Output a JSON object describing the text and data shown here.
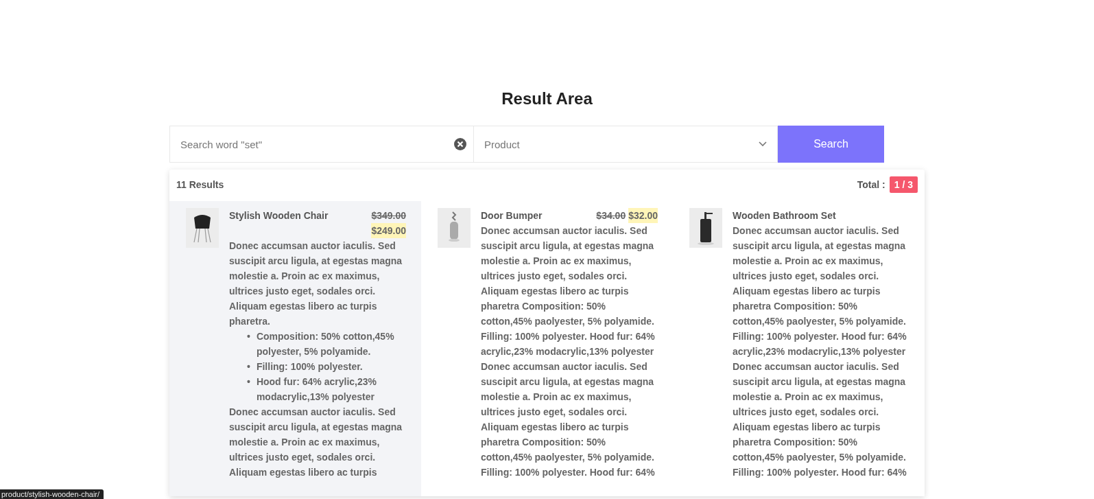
{
  "title": "Result Area",
  "search": {
    "placeholder": "Search word \"set\"",
    "category": "Product",
    "button": "Search"
  },
  "results": {
    "count": "11 Results",
    "total_label": "Total :",
    "page": "1 / 3",
    "items": [
      {
        "kind": "list",
        "hovered": true,
        "name": "Stylish Wooden Chair",
        "old_price": "$349.00",
        "price": "$249.00",
        "paragraphs": [
          "Donec accumsan auctor iaculis. Sed suscipit arcu ligula, at egestas magna molestie a. Proin ac ex maximus, ultrices justo eget, sodales orci. Aliquam egestas libero ac turpis pharetra."
        ],
        "bullets": [
          {
            "marker": "•",
            "label": "Composition:",
            "text": "50% cotton,45% polyester, 5% polyamide."
          },
          {
            "marker": "•",
            "label": "Filling:",
            "text": "100% polyester."
          },
          {
            "marker": "•",
            "label": "Hood fur:",
            "text": "64% acrylic,23% modacrylic,13% polyester"
          }
        ],
        "after": "Donec accumsan auctor iaculis. Sed suscipit arcu ligula, at egestas magna molestie a. Proin ac ex maximus, ultrices justo eget, sodales orci. Aliquam egestas libero ac turpis"
      },
      {
        "kind": "plain",
        "hovered": false,
        "name": "Door Bumper",
        "old_price": "$34.00",
        "price": "$32.00",
        "text": "Donec accumsan auctor iaculis. Sed suscipit arcu ligula, at egestas magna molestie a. Proin ac ex maximus, ultrices justo eget, sodales orci. Aliquam egestas libero ac turpis pharetra Composition: 50% cotton,45% paolyester, 5% polyamide. Filling: 100% polyester. Hood fur: 64% acrylic,23% modacrylic,13% polyester Donec accumsan auctor iaculis. Sed suscipit arcu ligula, at egestas magna molestie a. Proin ac ex maximus, ultrices justo eget, sodales orci. Aliquam egestas libero ac turpis pharetra Composition: 50% cotton,45% paolyester, 5% polyamide. Filling: 100% polyester. Hood fur: 64%"
      },
      {
        "kind": "plain",
        "hovered": false,
        "name": "Wooden Bathroom Set",
        "text": "Donec accumsan auctor iaculis. Sed suscipit arcu ligula, at egestas magna molestie a. Proin ac ex maximus, ultrices justo eget, sodales orci. Aliquam egestas libero ac turpis pharetra Composition: 50% cotton,45% paolyester, 5% polyamide. Filling: 100% polyester. Hood fur: 64% acrylic,23% modacrylic,13% polyester Donec accumsan auctor iaculis. Sed suscipit arcu ligula, at egestas magna molestie a. Proin ac ex maximus, ultrices justo eget, sodales orci. Aliquam egestas libero ac turpis pharetra Composition: 50% cotton,45% paolyester, 5% polyamide. Filling: 100% polyester. Hood fur: 64%"
      }
    ]
  },
  "status_url": "product/stylish-wooden-chair/"
}
